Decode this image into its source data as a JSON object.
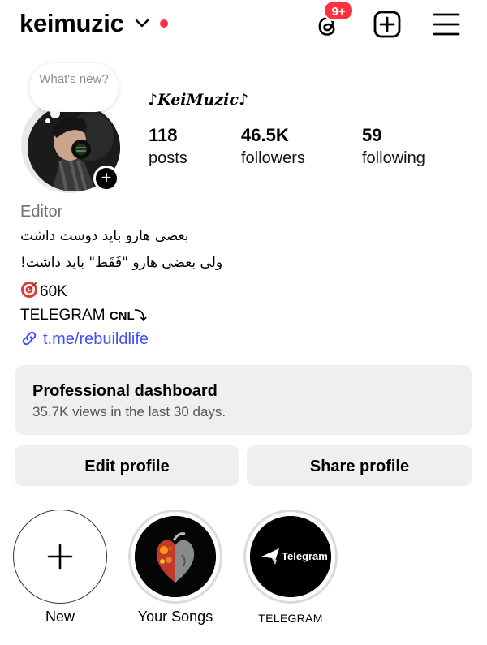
{
  "header": {
    "username": "keimuzic",
    "notification_badge": "9+",
    "icons": [
      "chevron-down-icon",
      "threads-icon",
      "create-post-icon",
      "menu-icon"
    ],
    "accent_color": "#ff3040"
  },
  "note": {
    "placeholder": "What's new?"
  },
  "profile": {
    "display_name": "♪KeiMuzic♪",
    "stats": [
      {
        "value": "118",
        "label": "posts"
      },
      {
        "value": "46.5K",
        "label": "followers"
      },
      {
        "value": "59",
        "label": "following"
      }
    ],
    "category": "Editor",
    "bio_lines": [
      "بعضی هارو باید دوست داشت",
      "ولی بعضی هارو \"فَقَط\" باید داشت!",
      "60K",
      "TELEGRAM",
      "CNL⤵"
    ],
    "link": "t.me/rebuildlife",
    "link_color": "#4150f7"
  },
  "dashboard": {
    "title": "Professional dashboard",
    "subtitle": "35.7K views in the last 30 days."
  },
  "actions": {
    "edit_label": "Edit profile",
    "share_label": "Share profile"
  },
  "highlights": [
    {
      "label": "New"
    },
    {
      "label": "Your Songs"
    },
    {
      "label": "TELEGRAM",
      "logo_text": "Telegram"
    }
  ]
}
